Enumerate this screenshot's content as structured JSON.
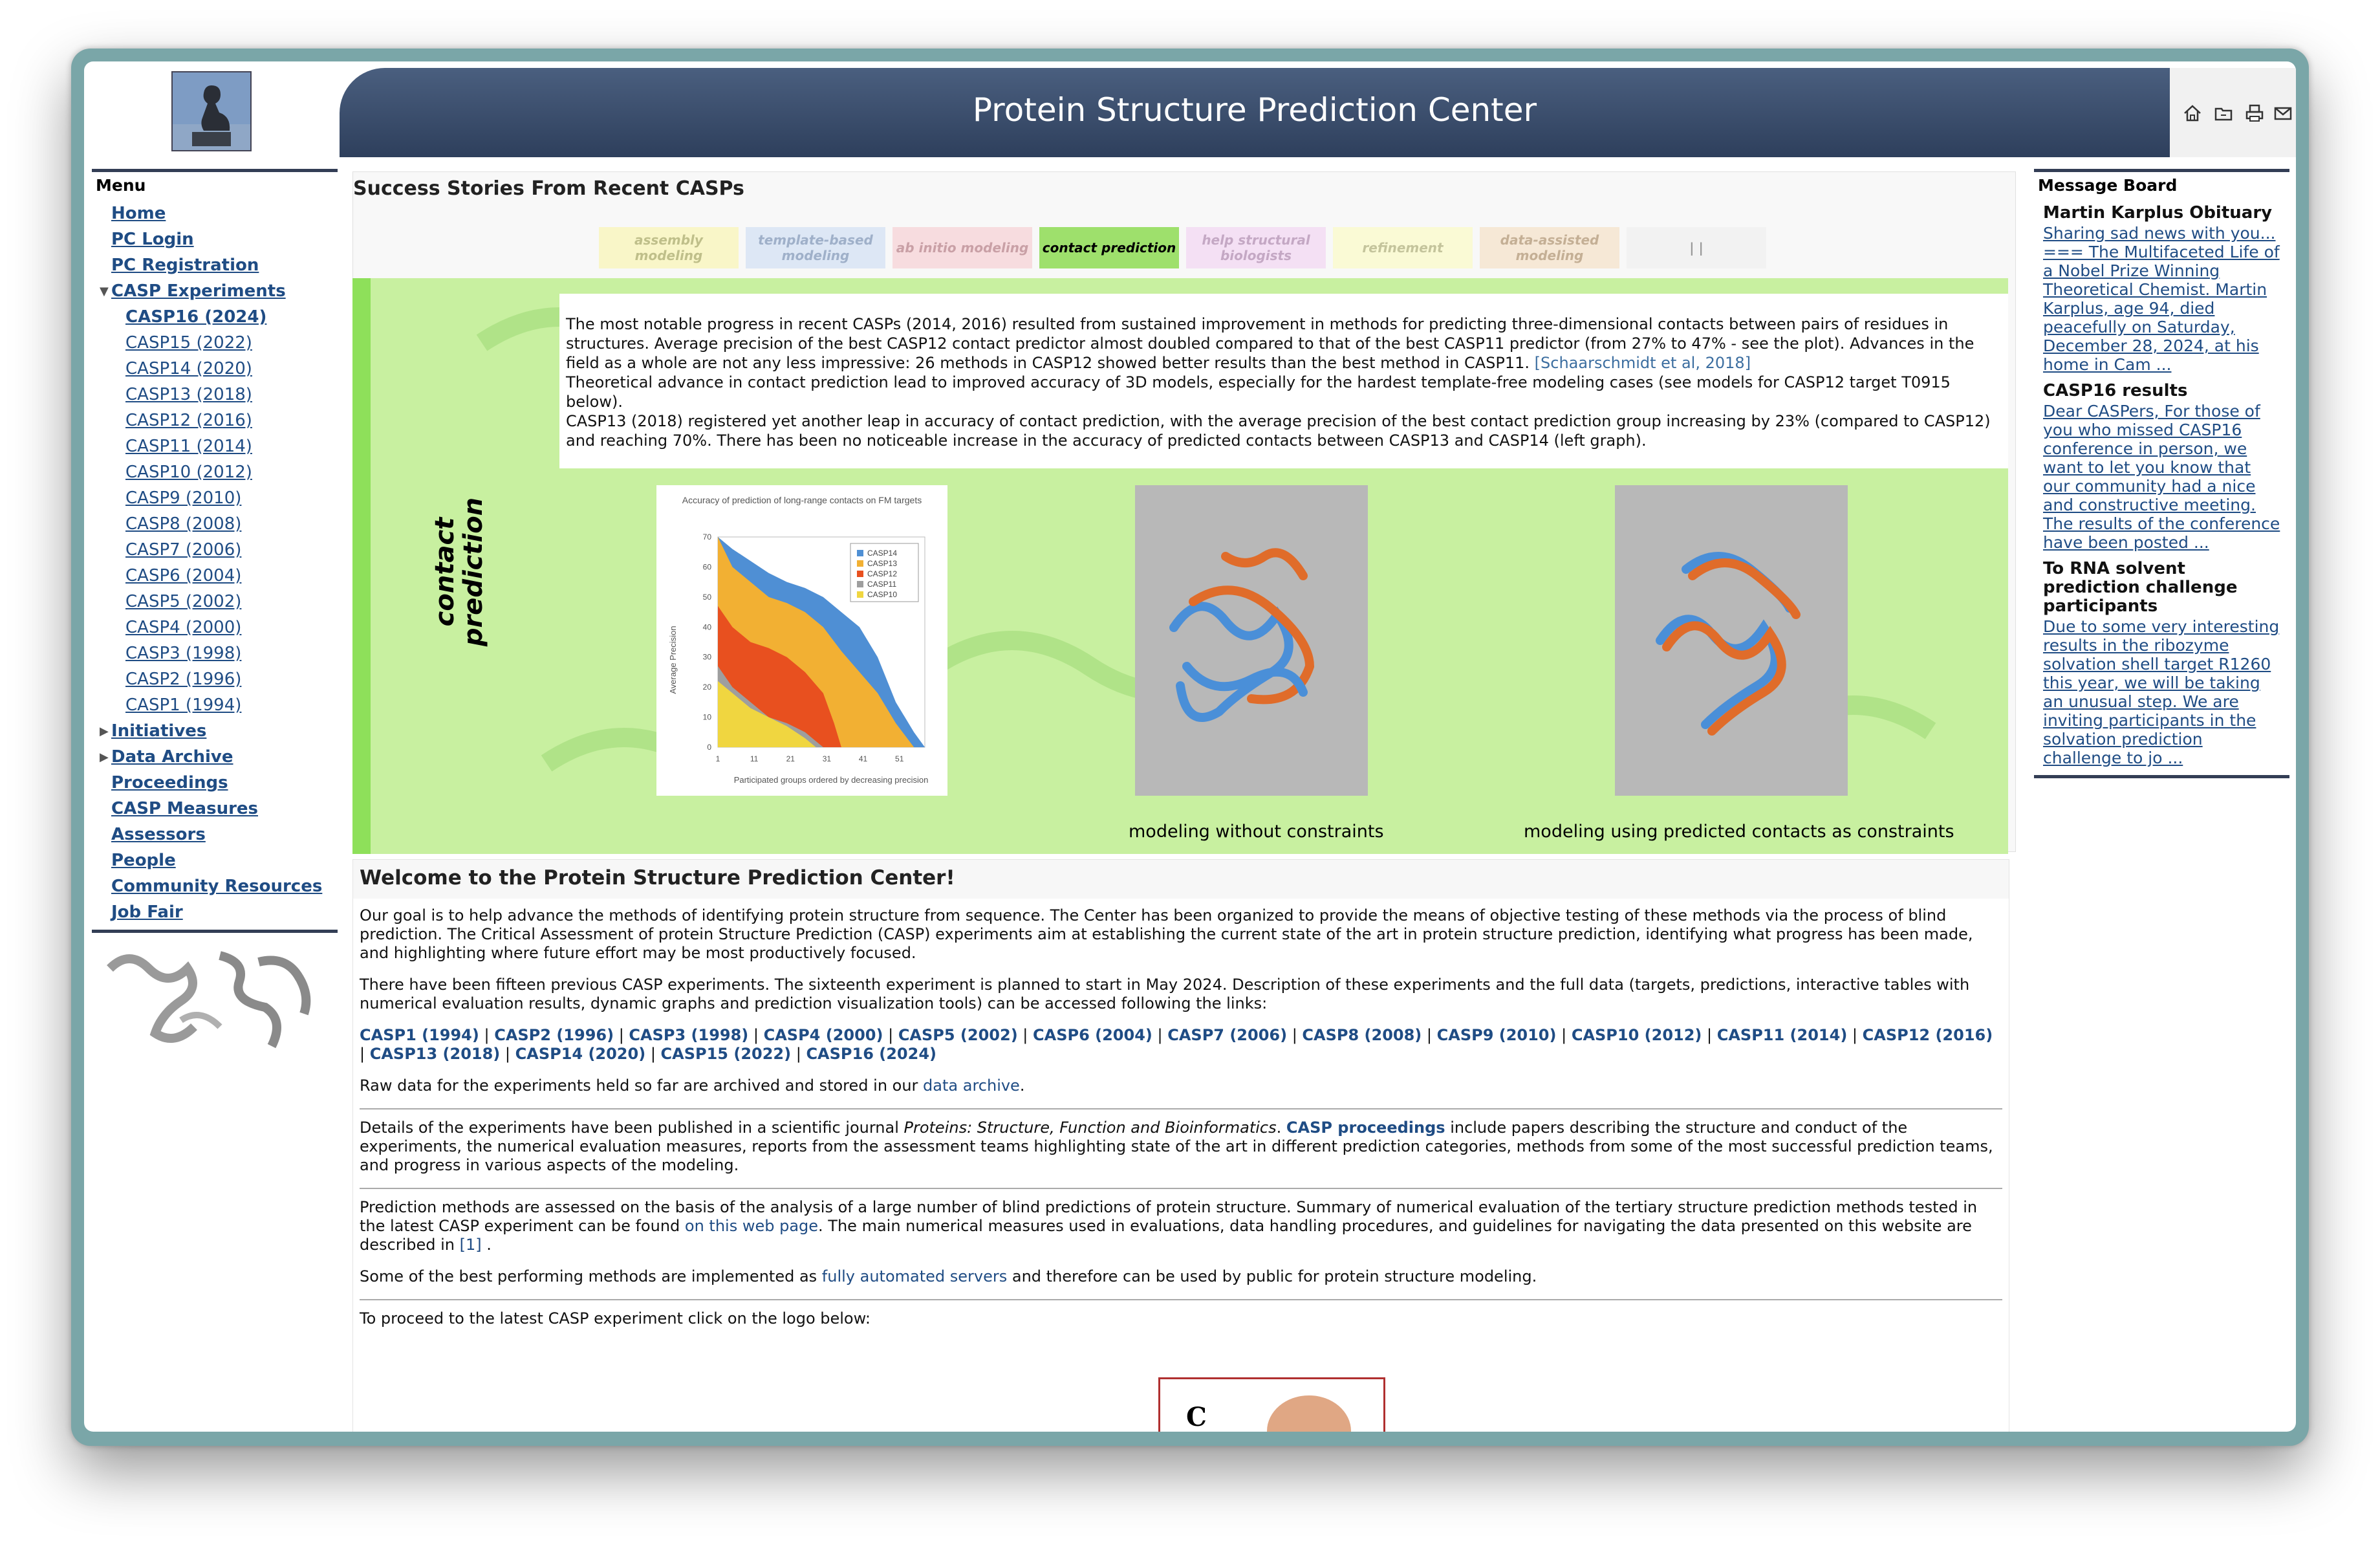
{
  "header": {
    "title": "Protein Structure Prediction Center",
    "icons": [
      "home-icon",
      "folder-icon",
      "print-icon",
      "mail-icon"
    ]
  },
  "menu": {
    "heading": "Menu",
    "items": [
      {
        "label": "Home"
      },
      {
        "label": "PC Login"
      },
      {
        "label": "PC Registration"
      },
      {
        "label": "CASP Experiments"
      },
      {
        "label": "CASP16 (2024)"
      },
      {
        "label": "CASP15 (2022)"
      },
      {
        "label": "CASP14 (2020)"
      },
      {
        "label": "CASP13 (2018)"
      },
      {
        "label": "CASP12 (2016)"
      },
      {
        "label": "CASP11 (2014)"
      },
      {
        "label": "CASP10 (2012)"
      },
      {
        "label": "CASP9 (2010)"
      },
      {
        "label": "CASP8 (2008)"
      },
      {
        "label": "CASP7 (2006)"
      },
      {
        "label": "CASP6 (2004)"
      },
      {
        "label": "CASP5 (2002)"
      },
      {
        "label": "CASP4 (2000)"
      },
      {
        "label": "CASP3 (1998)"
      },
      {
        "label": "CASP2 (1996)"
      },
      {
        "label": "CASP1 (1994)"
      },
      {
        "label": "Initiatives"
      },
      {
        "label": "Data Archive"
      },
      {
        "label": "Proceedings"
      },
      {
        "label": "CASP Measures"
      },
      {
        "label": "Assessors"
      },
      {
        "label": "People"
      },
      {
        "label": "Community Resources"
      },
      {
        "label": "Job Fair"
      }
    ]
  },
  "success": {
    "title": "Success Stories From Recent CASPs",
    "tabs": [
      {
        "label": "assembly modeling",
        "bg": "#f9f6c8",
        "fg": "#bfbf8a"
      },
      {
        "label": "template-based modeling",
        "bg": "#dde7f5",
        "fg": "#9fb0c9"
      },
      {
        "label": "ab initio modeling",
        "bg": "#f7dcdf",
        "fg": "#c9a0a6"
      },
      {
        "label": "contact prediction",
        "bg": "#9ee06c",
        "fg": "#000000"
      },
      {
        "label": "help structural biologists",
        "bg": "#f4e0f4",
        "fg": "#c4a8c4"
      },
      {
        "label": "refinement",
        "bg": "#fafad5",
        "fg": "#c4c49c"
      },
      {
        "label": "data-assisted modeling",
        "bg": "#f6e8d6",
        "fg": "#c4af95"
      },
      {
        "label": "| |",
        "bg": "#f2f2f2",
        "fg": "#999999"
      }
    ],
    "vertical_label": "contact prediction",
    "para1_a": "The most notable progress in recent CASPs (2014, 2016) resulted from sustained improvement in methods for predicting three-dimensional contacts between pairs of residues in structures. Average precision of the best CASP12 contact predictor almost doubled compared to that of the best CASP11 predictor (from 27% to 47% - see the plot). Advances in the field as a whole are not any less impressive: 26 methods in CASP12 showed better results than the best method in CASP11. ",
    "para1_link": "[Schaarschmidt et al, 2018]",
    "para2": "Theoretical advance in contact prediction lead to improved accuracy of 3D models, especially for the hardest template-free modeling cases (see models for CASP12 target T0915 below).",
    "para3": "CASP13 (2018) registered yet another leap in accuracy of contact prediction, with the average precision of the best contact prediction group increasing by 23% (compared to CASP12) and reaching 70%. There has been no noticeable increase in the accuracy of predicted contacts between CASP13 and CASP14 (left graph).",
    "caption1": "modeling without constraints",
    "caption2": "modeling using predicted contacts as constraints"
  },
  "chart_data": {
    "type": "area",
    "title": "Accuracy of prediction of long-range contacts on FM targets",
    "xlabel": "Participated groups ordered by decreasing precision",
    "ylabel": "Average Precision",
    "x_ticks": [
      "1",
      "11",
      "21",
      "31",
      "41",
      "51"
    ],
    "y_ticks": [
      "0",
      "10",
      "20",
      "30",
      "40",
      "50",
      "60",
      "70"
    ],
    "xlim": [
      1,
      58
    ],
    "ylim": [
      0,
      70
    ],
    "legend_position": "top-right",
    "series": [
      {
        "name": "CASP14",
        "color": "#4f8fd4",
        "x": [
          1,
          5,
          10,
          15,
          20,
          25,
          30,
          35,
          40,
          45,
          50,
          55,
          58
        ],
        "values": [
          70,
          66,
          62,
          58,
          55,
          53,
          50,
          45,
          40,
          30,
          15,
          5,
          0
        ]
      },
      {
        "name": "CASP13",
        "color": "#f2b033",
        "x": [
          1,
          5,
          10,
          15,
          20,
          25,
          30,
          35,
          40,
          45,
          50,
          55
        ],
        "values": [
          70,
          60,
          55,
          50,
          48,
          45,
          40,
          32,
          25,
          18,
          8,
          0
        ]
      },
      {
        "name": "CASP12",
        "color": "#e8501f",
        "x": [
          1,
          5,
          10,
          15,
          20,
          25,
          30,
          33,
          35
        ],
        "values": [
          47,
          40,
          35,
          33,
          30,
          25,
          18,
          8,
          0
        ]
      },
      {
        "name": "CASP11",
        "color": "#9e9e9e",
        "x": [
          1,
          5,
          10,
          15,
          20,
          25,
          30
        ],
        "values": [
          27,
          20,
          15,
          10,
          8,
          5,
          0
        ]
      },
      {
        "name": "CASP10",
        "color": "#f0d640",
        "x": [
          1,
          5,
          10,
          15,
          20,
          25,
          28
        ],
        "values": [
          22,
          18,
          13,
          10,
          7,
          3,
          0
        ]
      }
    ]
  },
  "welcome": {
    "title": "Welcome to the Protein Structure Prediction Center!",
    "p1": "Our goal is to help advance the methods of identifying protein structure from sequence. The Center has been organized to provide the means of objective testing of these methods via the process of blind prediction. The Critical Assessment of protein Structure Prediction (CASP) experiments aim at establishing the current state of the art in protein structure prediction, identifying what progress has been made, and highlighting where future effort may be most productively focused.",
    "p2": "There have been fifteen previous CASP experiments. The sixteenth experiment is planned to start in May 2024. Description of these experiments and the full data (targets, predictions, interactive tables with numerical evaluation results, dynamic graphs and prediction visualization tools) can be accessed following the links:",
    "casp_links": [
      "CASP1 (1994)",
      "CASP2 (1996)",
      "CASP3 (1998)",
      "CASP4 (2000)",
      "CASP5 (2002)",
      "CASP6 (2004)",
      "CASP7 (2006)",
      "CASP8 (2008)",
      "CASP9 (2010)",
      "CASP10 (2012)",
      "CASP11 (2014)",
      "CASP12 (2016)",
      "CASP13 (2018)",
      "CASP14 (2020)",
      "CASP15 (2022)",
      "CASP16 (2024)"
    ],
    "raw_a": "Raw data for the experiments held so far are archived and stored in our ",
    "raw_link": "data archive",
    "raw_b": ".",
    "det_a": "Details of the experiments have been published in a scientific journal ",
    "det_journal": "Proteins: Structure, Function and Bioinformatics",
    "det_sep": ". ",
    "det_link": "CASP proceedings",
    "det_b": " include papers describing the structure and conduct of the experiments, the numerical evaluation measures, reports from the assessment teams highlighting state of the art in different prediction categories, methods from some of the most successful prediction teams, and progress in various aspects of the modeling.",
    "pred_a": "Prediction methods are assessed on the basis of the analysis of a large number of blind predictions of protein structure. Summary of numerical evaluation of the tertiary structure prediction methods tested in the latest CASP experiment can be found ",
    "pred_link": "on this web page",
    "pred_b": ". The main numerical measures used in evaluations, data handling procedures, and guidelines for navigating the data presented on this website are described in ",
    "pred_ref": "[1] ",
    "pred_c": ".",
    "best_a": "Some of the best performing methods are implemented as ",
    "best_link": "fully automated servers",
    "best_b": " and therefore can be used by public for protein structure modeling.",
    "proceed": "To proceed to the latest CASP experiment click on the logo below:",
    "logo_letter": "C"
  },
  "board": {
    "heading": "Message Board",
    "messages": [
      {
        "title": "Martin Karplus Obituary",
        "body": "Sharing sad news with you... === The Multifaceted Life of a Nobel Prize Winning Theoretical Chemist. Martin Karplus, age 94, died peacefully on Saturday, December 28, 2024, at his home in Cam ..."
      },
      {
        "title": "CASP16 results",
        "body": "Dear CASPers, For those of you who missed CASP16 conference in person, we want to let you know that our community had a nice and constructive meeting. The results of the conference have been posted ..."
      },
      {
        "title": "To RNA solvent prediction challenge participants",
        "body": "Due to some very interesting results in the ribozyme solvation shell target R1260 this year, we will be taking an unusual step. We are inviting participants in the solvation prediction challenge to jo ..."
      }
    ]
  }
}
